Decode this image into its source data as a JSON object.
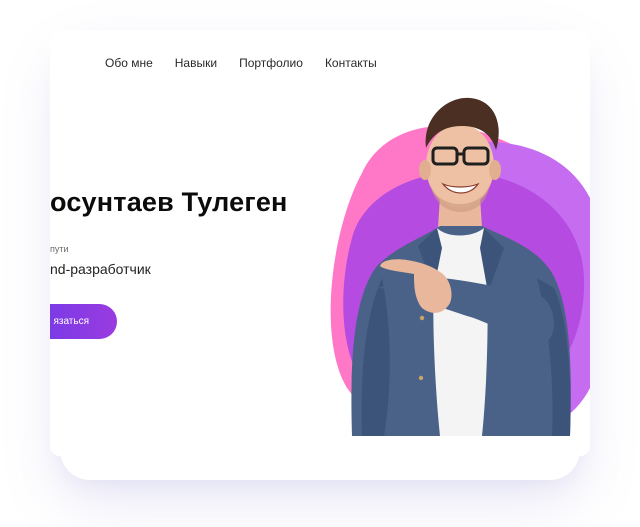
{
  "nav": {
    "items": [
      {
        "label": "Обо мне"
      },
      {
        "label": "Навыки"
      },
      {
        "label": "Портфолио"
      },
      {
        "label": "Контакты"
      }
    ]
  },
  "hero": {
    "title": "осунтаев Тулеген",
    "kicker": "пути",
    "role": "nd-разработчик",
    "cta_label": "язаться"
  },
  "colors": {
    "accent": "#7b3fe4",
    "blob_pink": "#ff78c8",
    "blob_violet": "#c56cf0",
    "blob_purple": "#b54be0",
    "shirt": "#4a6288"
  },
  "icons": {
    "portrait": "person-photo"
  }
}
